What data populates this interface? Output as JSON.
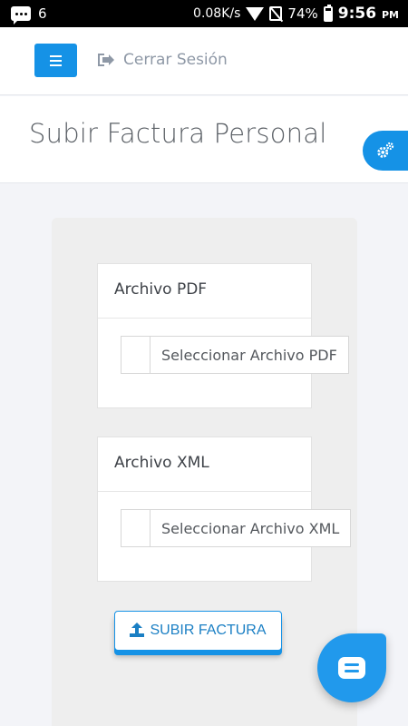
{
  "status_bar": {
    "notification_count": "6",
    "net_speed": "0.08K/s",
    "battery": "74%",
    "time": "9:56",
    "ampm": "PM"
  },
  "nav": {
    "menu_icon": "hamburger-icon",
    "logout_icon": "sign-out-icon",
    "logout_label": "Cerrar Sesión"
  },
  "page": {
    "title": "Subir Factura Personal",
    "settings_icon": "gears-icon"
  },
  "pdf_card": {
    "title": "Archivo PDF",
    "file_label": "Seleccionar Archivo PDF"
  },
  "xml_card": {
    "title": "Archivo XML",
    "file_label": "Seleccionar Archivo XML"
  },
  "submit": {
    "label": "SUBIR FACTURA",
    "icon": "upload-icon"
  },
  "chat": {
    "icon": "chat-icon"
  },
  "colors": {
    "accent": "#1592e6",
    "background": "#f3f4f8",
    "panel": "#eeeeee"
  }
}
